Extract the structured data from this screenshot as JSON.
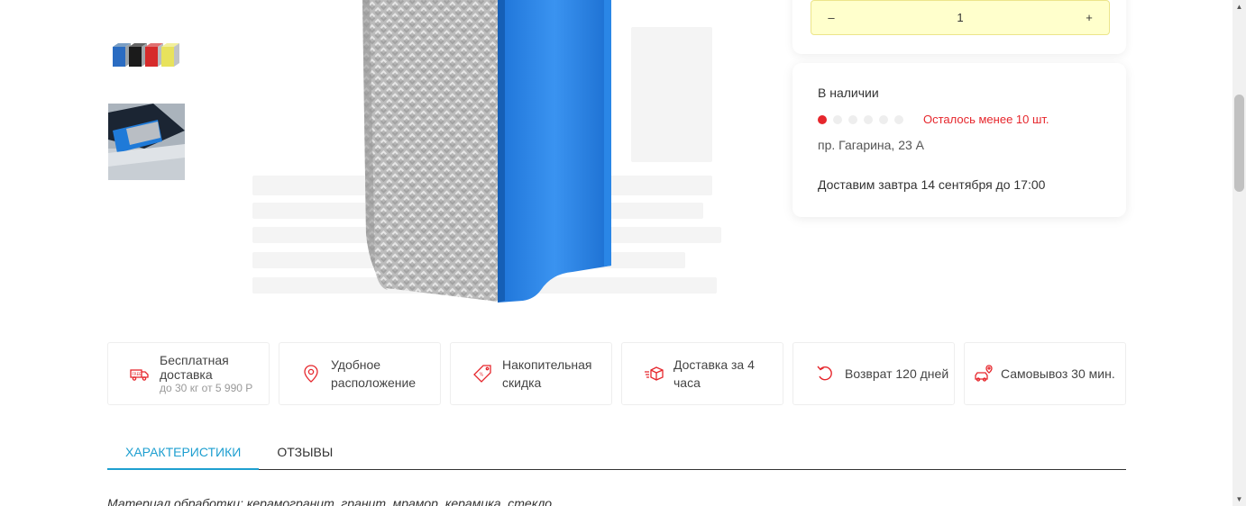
{
  "quantity": {
    "minus": "–",
    "value": "1",
    "plus": "+"
  },
  "stock": {
    "title": "В наличии",
    "level_filled": 1,
    "level_total": 6,
    "remaining": "Осталось менее 10 шт.",
    "address": "пр. Гагарина, 23 А",
    "delivery": "Доставим завтра 14 сентября до 17:00"
  },
  "features": [
    {
      "icon": "truck-icon",
      "label": "Бесплатная доставка",
      "sub": "до 30 кг от 5 990 Р"
    },
    {
      "icon": "location-pin-icon",
      "label": "Удобное расположение"
    },
    {
      "icon": "price-tag-icon",
      "label": "Накопительная скидка"
    },
    {
      "icon": "fast-box-icon",
      "label": "Доставка за 4 часа"
    },
    {
      "icon": "return-arrow-icon",
      "label": "Возврат 120 дней"
    },
    {
      "icon": "car-pin-icon",
      "label": "Самовывоз 30 мин."
    }
  ],
  "tabs": [
    {
      "label": "Характеристики",
      "active": true
    },
    {
      "label": "Отзывы",
      "active": false
    }
  ],
  "description": "Материал обработки: керамогранит, гранит, мрамор, керамика, стекло",
  "colors": {
    "accent_red": "#e6262c",
    "accent_blue": "#1e9fd0",
    "qty_bg": "#ffffcc"
  }
}
